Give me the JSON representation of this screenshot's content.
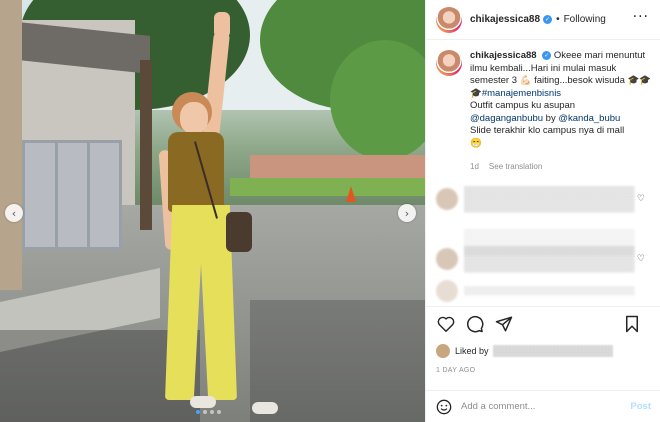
{
  "post": {
    "username": "chikajessica88",
    "verified_icon": "verified-badge-icon",
    "separator": "•",
    "follow_status": "Following",
    "more_icon": "more-options-icon",
    "nav": {
      "prev_icon": "chevron-left-icon",
      "next_icon": "chevron-right-icon"
    },
    "carousel": {
      "dot_count": 4,
      "active_index": 0
    }
  },
  "caption": {
    "username": "chikajessica88",
    "text_1": "Okeee mari menuntut ilmu kembali...Hari ini mulai masuk semester 3 ",
    "emoji_1": "💪🏻",
    "text_2": " faiting...besok wisuda ",
    "emoji_2": "🎓🎓🎓",
    "hashtag": "#manajemenbisnis",
    "line_outfit": "Outfit campus ku asupan",
    "mention_1": "@daganganbubu",
    "by_text": " by ",
    "mention_2": "@kanda_bubu",
    "line_slide": "Slide terakhir klo campus nya di mall",
    "emoji_3": "😁",
    "time": "1d",
    "see_translation": "See translation"
  },
  "actions": {
    "like_icon": "heart-icon",
    "comment_icon": "comment-icon",
    "share_icon": "share-icon",
    "save_icon": "bookmark-icon"
  },
  "likes": {
    "prefix": "Liked by"
  },
  "timestamp": "1 DAY AGO",
  "comment": {
    "placeholder": "Add a comment...",
    "post_label": "Post",
    "emoji_icon": "emoji-icon"
  },
  "colors": {
    "link": "#00376b",
    "verified": "#3897f0",
    "post_disabled": "#b2dffc",
    "meta": "#8e8e8e"
  }
}
